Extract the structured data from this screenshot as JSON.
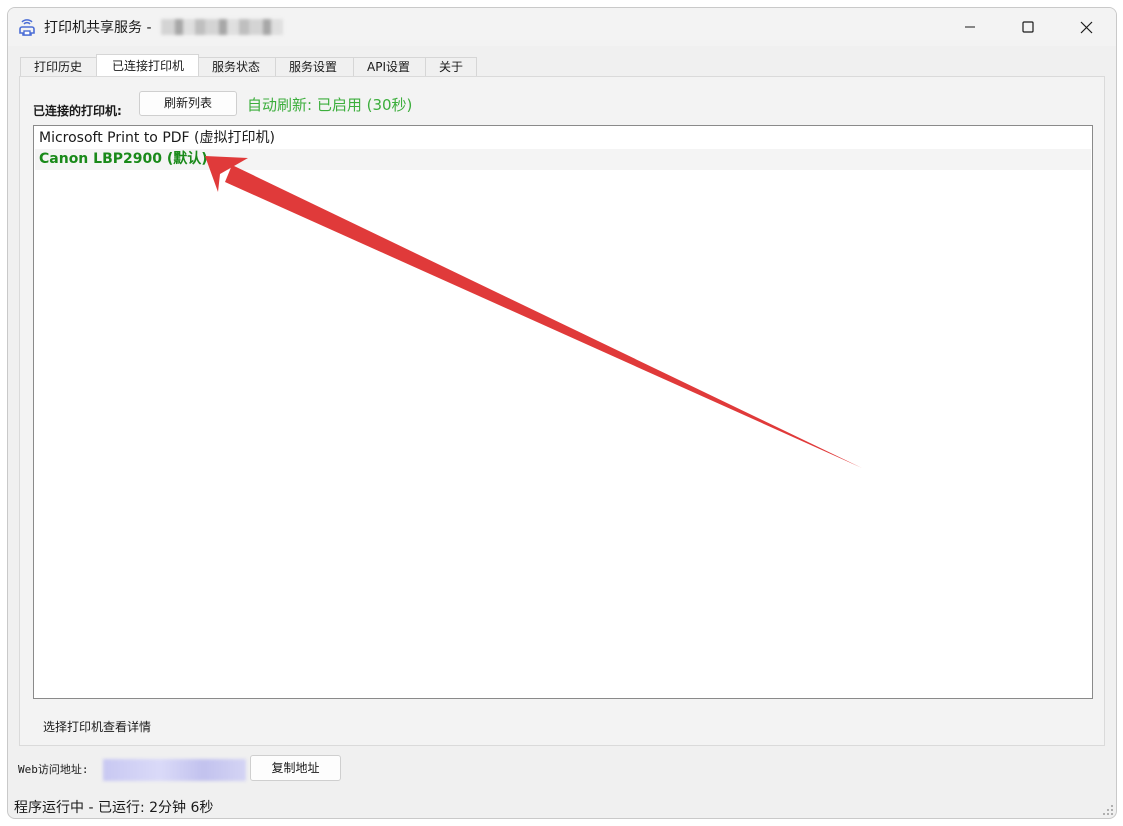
{
  "window": {
    "title": "打印机共享服务 -",
    "controls": {
      "minimize": "—",
      "maximize": "☐",
      "close": "✕"
    }
  },
  "tabs": [
    {
      "label": "打印历史",
      "active": false
    },
    {
      "label": "已连接打印机",
      "active": true
    },
    {
      "label": "服务状态",
      "active": false
    },
    {
      "label": "服务设置",
      "active": false
    },
    {
      "label": "API设置",
      "active": false
    },
    {
      "label": "关于",
      "active": false
    }
  ],
  "printers_panel": {
    "label": "已连接的打印机:",
    "refresh_button": "刷新列表",
    "auto_refresh": "自动刷新: 已启用 (30秒)",
    "items": [
      {
        "text": "Microsoft Print to PDF  (虚拟打印机)",
        "status": "normal"
      },
      {
        "text": "Canon LBP2900 (默认)",
        "status": "default"
      }
    ],
    "detail_hint": "选择打印机查看详情"
  },
  "web_access": {
    "label": "Web访问地址:",
    "copy_button": "复制地址"
  },
  "status_bar": {
    "text": "程序运行中 - 已运行: 2分钟 6秒"
  },
  "colors": {
    "accent_green": "#3cae3c",
    "default_printer_green": "#1a8a1a",
    "annotation_arrow": "#e03a3a"
  }
}
